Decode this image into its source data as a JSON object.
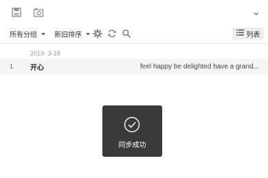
{
  "topbar": {
    "icons": [
      "save-icon",
      "camera-icon",
      "chevron-down-icon"
    ]
  },
  "toolbar": {
    "group_filter": "所有分组",
    "sort": "新旧排序",
    "icons": [
      "gear-icon",
      "sync-icon",
      "search-icon"
    ],
    "view_button": "列表"
  },
  "list": {
    "date": "2019- 3-18",
    "rows": [
      {
        "number": "1",
        "title": "开心",
        "description": "feel happy be delighted have a grand..."
      }
    ]
  },
  "toast": {
    "icon": "check-circle-icon",
    "message": "同步成功"
  },
  "colors": {
    "toast_bg": "#3a3a3a",
    "row_bg": "#f5f5f5",
    "icon": "#8a8a8a"
  }
}
